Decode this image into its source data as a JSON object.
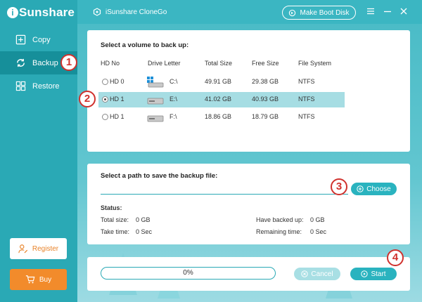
{
  "brand": {
    "logo_i": "i",
    "logo_rest": "Sunshare"
  },
  "window": {
    "title": "iSunshare CloneGo",
    "boot_disk_label": "Make Boot Disk"
  },
  "sidebar": {
    "items": [
      {
        "label": "Copy",
        "icon": "copy-icon"
      },
      {
        "label": "Backup",
        "icon": "backup-icon"
      },
      {
        "label": "Restore",
        "icon": "restore-icon"
      }
    ],
    "register_label": "Register",
    "buy_label": "Buy"
  },
  "markers": [
    "1",
    "2",
    "3",
    "4"
  ],
  "volumes": {
    "title": "Select a volume to back up:",
    "columns": [
      "HD No",
      "Drive Letter",
      "Total Size",
      "Free Size",
      "File System"
    ],
    "rows": [
      {
        "hd": "HD 0",
        "letter": "C:\\",
        "total": "49.91 GB",
        "free": "29.38 GB",
        "fs": "NTFS",
        "selected": false,
        "icon": "windows-drive-icon"
      },
      {
        "hd": "HD 1",
        "letter": "E:\\",
        "total": "41.02 GB",
        "free": "40.93 GB",
        "fs": "NTFS",
        "selected": true,
        "icon": "drive-icon"
      },
      {
        "hd": "HD 1",
        "letter": "F:\\",
        "total": "18.86 GB",
        "free": "18.79 GB",
        "fs": "NTFS",
        "selected": false,
        "icon": "drive-icon"
      }
    ]
  },
  "path": {
    "title": "Select a path to save the backup file:",
    "value": "",
    "choose_label": "Choose"
  },
  "status": {
    "heading": "Status:",
    "total_size_label": "Total size:",
    "total_size_value": "0 GB",
    "take_time_label": "Take time:",
    "take_time_value": "0 Sec",
    "backed_up_label": "Have backed up:",
    "backed_up_value": "0 GB",
    "remaining_label": "Remaining time:",
    "remaining_value": "0 Sec"
  },
  "progress": {
    "percent_text": "0%",
    "fraction": 0
  },
  "actions": {
    "cancel_label": "Cancel",
    "start_label": "Start"
  },
  "colors": {
    "accent": "#2aa9b5",
    "active_nav": "#168f9a",
    "marker": "#d0312d",
    "buy": "#f28b2b"
  }
}
